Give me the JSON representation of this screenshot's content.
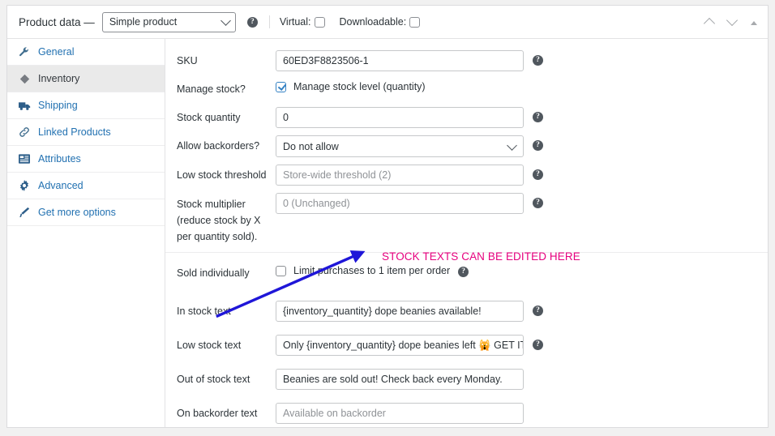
{
  "header": {
    "title": "Product data —",
    "product_type": "Simple product",
    "help_icon": "help-icon",
    "virtual_label": "Virtual:",
    "virtual_checked": false,
    "downloadable_label": "Downloadable:",
    "downloadable_checked": false,
    "move_up_icon": "chevron-up-icon",
    "move_down_icon": "chevron-down-icon",
    "collapse_icon": "triangle-up-icon"
  },
  "sidebar": {
    "items": [
      {
        "label": "General",
        "icon": "wrench-icon",
        "active": false
      },
      {
        "label": "Inventory",
        "icon": "box-icon",
        "active": true
      },
      {
        "label": "Shipping",
        "icon": "truck-icon",
        "active": false
      },
      {
        "label": "Linked Products",
        "icon": "link-icon",
        "active": false
      },
      {
        "label": "Attributes",
        "icon": "list-icon",
        "active": false
      },
      {
        "label": "Advanced",
        "icon": "gear-icon",
        "active": false
      },
      {
        "label": "Get more options",
        "icon": "megaphone-icon",
        "active": false
      }
    ]
  },
  "inventory": {
    "sku": {
      "label": "SKU",
      "value": "60ED3F8823506-1",
      "is_placeholder": false
    },
    "manage_stock": {
      "label": "Manage stock?",
      "checkbox_label": "Manage stock level (quantity)",
      "checked": true
    },
    "stock_quantity": {
      "label": "Stock quantity",
      "value": "0",
      "is_placeholder": false
    },
    "allow_backorders": {
      "label": "Allow backorders?",
      "value": "Do not allow"
    },
    "low_stock_threshold": {
      "label": "Low stock threshold",
      "value": "Store-wide threshold (2)",
      "is_placeholder": true
    },
    "stock_multiplier": {
      "label": "Stock multiplier (reduce stock by X per quantity sold).",
      "value": "0 (Unchanged)",
      "is_placeholder": true
    },
    "sold_individually": {
      "label": "Sold individually",
      "checkbox_label": "Limit purchases to 1 item per order",
      "checked": false
    },
    "in_stock_text": {
      "label": "In stock text",
      "value": "{inventory_quantity} dope beanies available!",
      "is_placeholder": false
    },
    "low_stock_text": {
      "label": "Low stock text",
      "value": "Only {inventory_quantity} dope beanies left 🙀 GET IT QUC",
      "is_placeholder": false
    },
    "out_of_stock_text": {
      "label": "Out of stock text",
      "value": "Beanies are sold out! Check back every Monday.",
      "is_placeholder": false
    },
    "on_backorder_text": {
      "label": "On backorder text",
      "value": "Available on backorder",
      "is_placeholder": true
    }
  },
  "annotation": {
    "text": "STOCK TEXTS CAN BE EDITED HERE",
    "color": "#e6007e",
    "arrow_color": "#1f16d8"
  }
}
